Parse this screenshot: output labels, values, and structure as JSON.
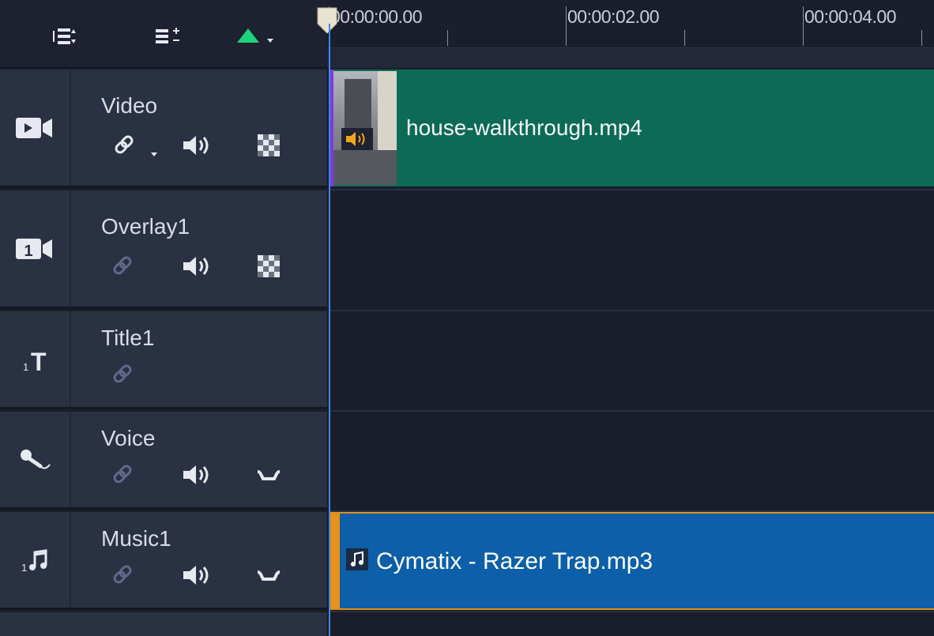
{
  "toolbar": {
    "buttons": [
      {
        "icon": "track-manager-icon"
      },
      {
        "icon": "add-remove-chapter-icon"
      },
      {
        "icon": "green-triangle-menu-icon"
      }
    ],
    "accent_color": "#1fd37a"
  },
  "ruler": {
    "ticks": [
      "00:00:00.00",
      "00:00:02.00",
      "00:00:04.00"
    ]
  },
  "tracks": [
    {
      "name": "Video",
      "icon": "video-camera-icon",
      "controls": [
        "link-icon",
        "speaker-icon",
        "checker-icon"
      ]
    },
    {
      "name": "Overlay1",
      "icon": "overlay-camera-icon",
      "controls": [
        "link-icon",
        "speaker-icon",
        "checker-icon"
      ]
    },
    {
      "name": "Title1",
      "icon": "title-t-icon",
      "controls": [
        "link-icon"
      ]
    },
    {
      "name": "Voice",
      "icon": "microphone-icon",
      "controls": [
        "link-icon",
        "speaker-icon",
        "wave-icon"
      ]
    },
    {
      "name": "Music1",
      "icon": "music-note-icon",
      "controls": [
        "link-icon",
        "speaker-icon",
        "wave-icon"
      ]
    }
  ],
  "clips": {
    "video": {
      "name": "house-walkthrough.mp4",
      "color": "#0d6b55"
    },
    "music": {
      "name": "Cymatix - Razer Trap.mp3",
      "color": "#0c5fa8",
      "border": "#e08f1a"
    }
  }
}
